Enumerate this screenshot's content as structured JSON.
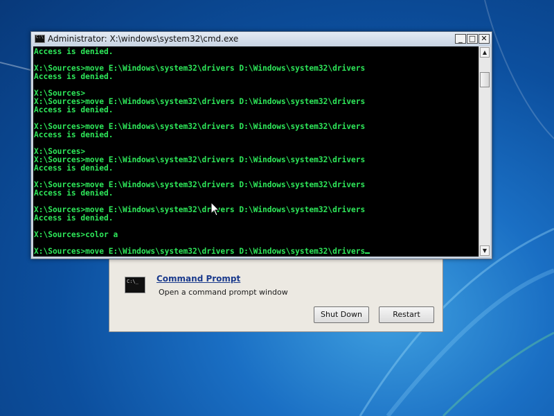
{
  "cmd_window": {
    "title": "Administrator: X:\\windows\\system32\\cmd.exe",
    "minimize_glyph": "_",
    "maximize_glyph": "□",
    "close_glyph": "✕",
    "text_color": "#2ee85a",
    "console_lines": [
      "Access is denied.",
      "",
      "X:\\Sources>move E:\\Windows\\system32\\drivers D:\\Windows\\system32\\drivers",
      "Access is denied.",
      "",
      "X:\\Sources>",
      "X:\\Sources>move E:\\Windows\\system32\\drivers D:\\Windows\\system32\\drivers",
      "Access is denied.",
      "",
      "X:\\Sources>move E:\\Windows\\system32\\drivers D:\\Windows\\system32\\drivers",
      "Access is denied.",
      "",
      "X:\\Sources>",
      "X:\\Sources>move E:\\Windows\\system32\\drivers D:\\Windows\\system32\\drivers",
      "Access is denied.",
      "",
      "X:\\Sources>move E:\\Windows\\system32\\drivers D:\\Windows\\system32\\drivers",
      "Access is denied.",
      "",
      "X:\\Sources>move E:\\Windows\\system32\\drivers D:\\Windows\\system32\\drivers",
      "Access is denied.",
      "",
      "X:\\Sources>color a",
      "",
      "X:\\Sources>move E:\\Windows\\system32\\drivers D:\\Windows\\system32\\drivers"
    ]
  },
  "recovery_dialog": {
    "command_prompt_title": "Command Prompt",
    "command_prompt_desc": "Open a command prompt window",
    "icon_text": "C:\\_",
    "shut_down_label": "Shut Down",
    "restart_label": "Restart"
  }
}
